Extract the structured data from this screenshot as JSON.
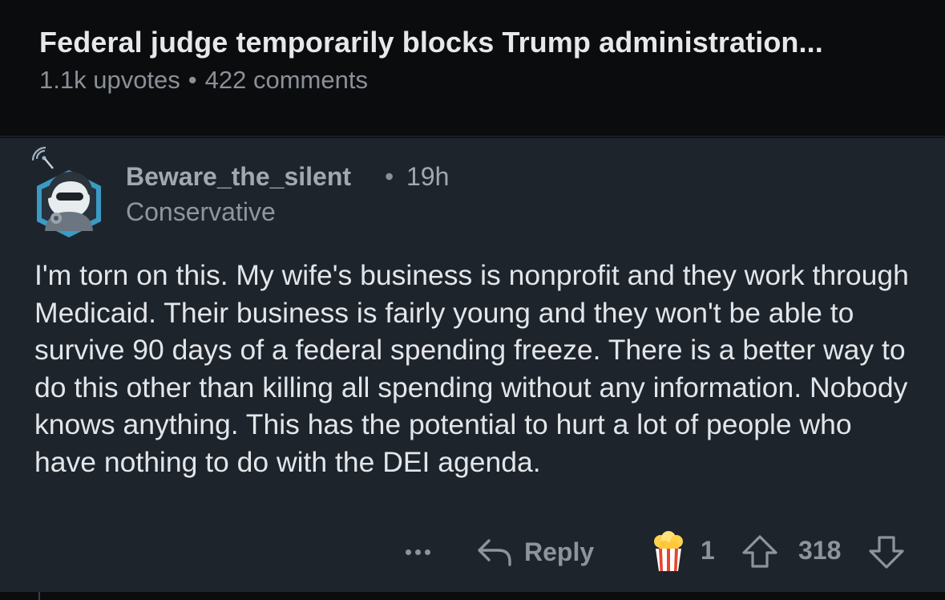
{
  "post": {
    "title": "Federal judge temporarily blocks Trump administration...",
    "upvotes": "1.1k upvotes",
    "separator": "•",
    "comments": "422 comments"
  },
  "comment": {
    "username": "Beware_the_silent",
    "separator": "•",
    "timestamp": "19h",
    "flair": "Conservative",
    "body": "I'm torn on this. My wife's business is nonprofit and they work through Medicaid. Their business is fairly young and they won't be able to survive 90 days of a federal spending freeze. There is a better way to do this other than killing all spending without any information. Nobody knows anything. This has the potential to hurt a lot of people who have nothing to do with the DEI agenda.",
    "avatar_icon": "snoo-avatar-icon",
    "actions": {
      "more_icon": "more-dots-icon",
      "reply_icon": "reply-arrow-icon",
      "reply_label": "Reply",
      "award_icon": "popcorn-award-icon",
      "award_count": "1",
      "upvote_icon": "upvote-arrow-icon",
      "score": "318",
      "downvote_icon": "downvote-arrow-icon"
    }
  },
  "colors": {
    "header_bg": "#0b0c0d",
    "card_bg": "#1e242c",
    "text_primary": "#e3e6e9",
    "text_secondary": "#8e949a"
  }
}
